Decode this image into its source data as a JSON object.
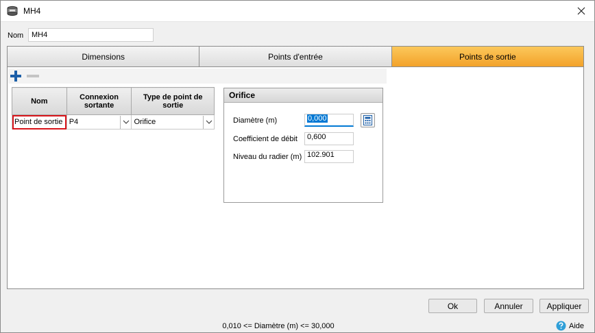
{
  "window": {
    "title": "MH4",
    "close_glyph": "✕"
  },
  "name_field": {
    "label": "Nom",
    "value": "MH4"
  },
  "tabs": [
    {
      "label": "Dimensions",
      "active": false
    },
    {
      "label": "Points d'entrée",
      "active": false
    },
    {
      "label": "Points de sortie",
      "active": true
    }
  ],
  "toolbar": {
    "add_icon": "plus-icon",
    "remove_icon": "minus-icon"
  },
  "grid": {
    "headers": [
      "Nom",
      "Connexion sortante",
      "Type de point de sortie"
    ],
    "rows": [
      {
        "name": "Point de sortie",
        "connection": "P4",
        "type": "Orifice"
      }
    ]
  },
  "orifice": {
    "title": "Orifice",
    "fields": [
      {
        "label": "Diamètre (m)",
        "value": "0,000"
      },
      {
        "label": "Coefficient de débit",
        "value": "0,600"
      },
      {
        "label": "Niveau du radier (m)",
        "value": "102.901"
      }
    ]
  },
  "buttons": {
    "ok": "Ok",
    "cancel": "Annuler",
    "apply": "Appliquer"
  },
  "status": "0,010 <= Diamètre (m) <= 30,000",
  "help": {
    "label": "Aide"
  },
  "colors": {
    "active_tab": "#f7b440",
    "selection": "#0078d4",
    "error_outline": "#d8141a",
    "accent_icon": "#1c5fa8"
  }
}
